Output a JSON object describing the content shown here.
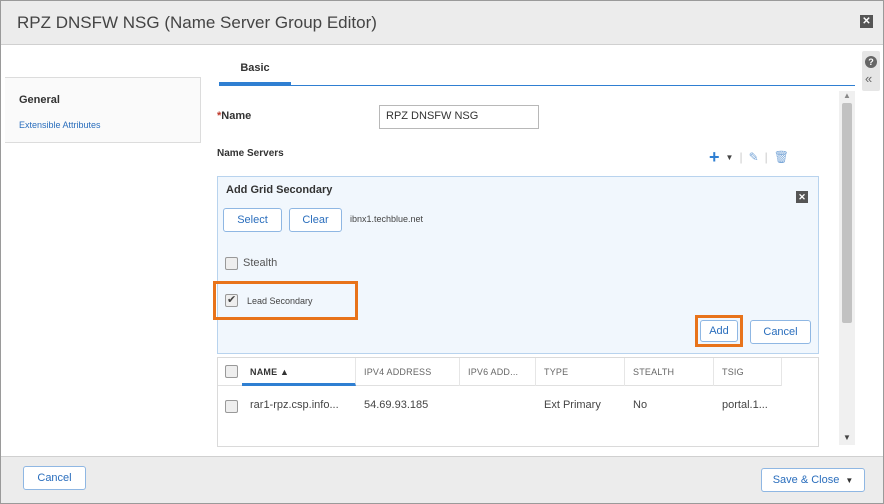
{
  "window": {
    "title": "RPZ DNSFW NSG (Name Server Group Editor)"
  },
  "nav": {
    "general": "General",
    "extensible": "Extensible Attributes"
  },
  "tabs": [
    {
      "label": "Basic"
    }
  ],
  "form": {
    "name_required_marker": "*",
    "name_label": "Name",
    "name_value": "RPZ DNSFW NSG",
    "name_servers_label": "Name Servers"
  },
  "panel": {
    "title": "Add Grid Secondary",
    "select_label": "Select",
    "clear_label": "Clear",
    "server": "ibnx1.techblue.net",
    "stealth_label": "Stealth",
    "stealth_checked": false,
    "lead_label": "Lead Secondary",
    "lead_checked": true,
    "add_label": "Add",
    "cancel_label": "Cancel"
  },
  "grid": {
    "columns": [
      "NAME ▲",
      "IPV4 ADDRESS",
      "IPV6 ADD...",
      "TYPE",
      "STEALTH",
      "TSIG"
    ],
    "rows": [
      {
        "name": "rar1-rpz.csp.info...",
        "ipv4": "54.69.93.185",
        "ipv6": "",
        "type": "Ext Primary",
        "stealth": "No",
        "tsig": "portal.1..."
      }
    ]
  },
  "footer": {
    "cancel_label": "Cancel",
    "save_label": "Save & Close"
  },
  "colors": {
    "accent": "#2f7fd2",
    "highlight": "#e8731a",
    "panel_bg": "#f1f7fd"
  },
  "icons": [
    "close-icon",
    "help-icon",
    "collapse-icon",
    "add-icon",
    "edit-icon",
    "delete-icon",
    "dropdown-icon"
  ]
}
